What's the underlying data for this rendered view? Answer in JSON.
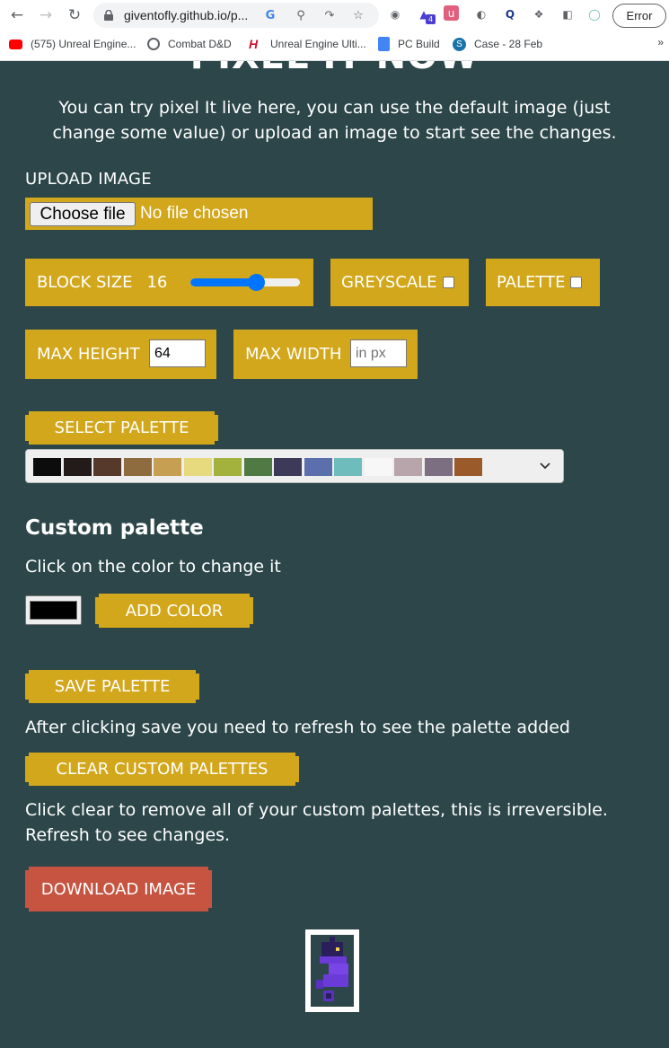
{
  "browser": {
    "url": "giventofly.github.io/p...",
    "error_label": "Error",
    "extension_badge": "4",
    "bookmarks": [
      {
        "label": "(575) Unreal Engine..."
      },
      {
        "label": "Combat D&D"
      },
      {
        "label": "Unreal Engine Ulti..."
      },
      {
        "label": "PC Build"
      },
      {
        "label": "Case - 28 Feb"
      }
    ],
    "more_label": "»"
  },
  "page": {
    "title": "PIXEL IT NOW",
    "intro": "You can try pixel It live here, you can use the default image (just change some value) or upload an image to start see the changes.",
    "upload": {
      "label": "UPLOAD IMAGE",
      "button": "Choose file",
      "status": "No file chosen"
    },
    "block_size": {
      "label": "BLOCK SIZE",
      "value": "16",
      "slider_fraction": 0.6
    },
    "greyscale": {
      "label": "GREYSCALE",
      "checked": false
    },
    "palette_toggle": {
      "label": "PALETTE",
      "checked": false
    },
    "max_height": {
      "label": "MAX HEIGHT",
      "value": "64"
    },
    "max_width": {
      "label": "MAX WIDTH",
      "placeholder": "in px"
    },
    "select_palette": {
      "label": "SELECT PALETTE"
    },
    "palette_colors": [
      "#0c0c0c",
      "#231a1a",
      "#56392a",
      "#8f6c3f",
      "#c69f53",
      "#e7d97d",
      "#a3b13d",
      "#4f7a44",
      "#3c3a58",
      "#5a6fab",
      "#6fbcbd",
      "#f7f7f7",
      "#b8a5ab",
      "#7b6f81",
      "#9b5a29"
    ],
    "custom_palette": {
      "heading": "Custom palette",
      "instruction": "Click on the color to change it",
      "current_color": "#000000",
      "add_button": "ADD COLOR"
    },
    "save_palette": {
      "button": "SAVE PALETTE",
      "note": "After clicking save you need to refresh to see the palette added"
    },
    "clear_palettes": {
      "button": "CLEAR CUSTOM PALETTES",
      "note_line1": "Click clear to remove all of your custom palettes, this is irreversible.",
      "note_line2": "Refresh to see changes."
    },
    "download": {
      "button": "DOWNLOAD IMAGE"
    }
  },
  "colors": {
    "background": "#2c4649",
    "gold": "#d2a71b",
    "download_red": "#c65440",
    "slider_blue": "#0075ff"
  }
}
